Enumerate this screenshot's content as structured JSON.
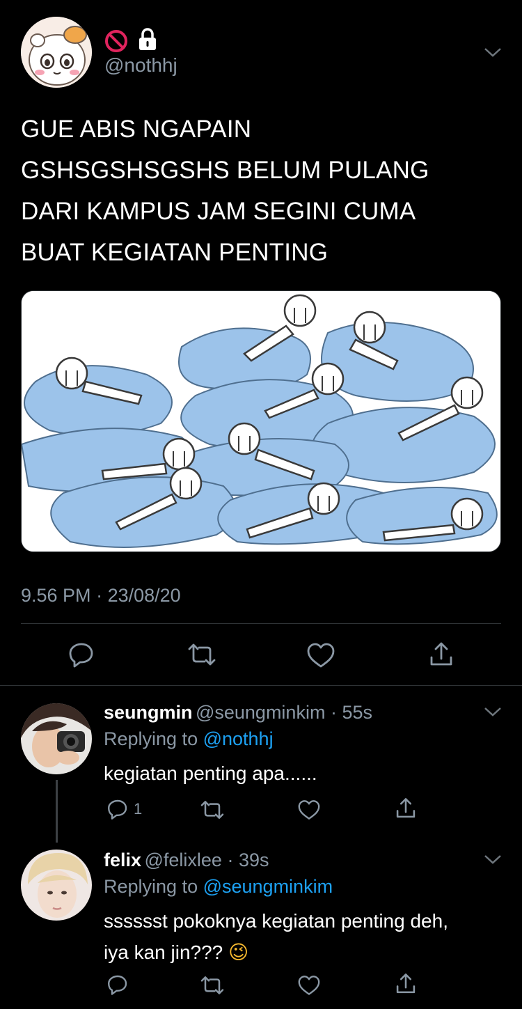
{
  "main_tweet": {
    "handle": "@nothhj",
    "status_icons": [
      "no-entry-icon",
      "lock-icon"
    ],
    "text_lines": [
      "GUE ABIS NGAPAIN",
      "GSHSGSHSGSHS BELUM PULANG",
      "DARI KAMPUS JAM SEGINI CUMA",
      "BUAT KEGIATAN PENTING"
    ],
    "time": "9.56 PM",
    "separator": " · ",
    "date": "23/08/20"
  },
  "replies": [
    {
      "name": "seungmin",
      "handle": "@seungminkim",
      "dot": " · ",
      "time": "55s",
      "replying_prefix": "Replying to ",
      "replying_to": "@nothhj",
      "text_lines": [
        "kegiatan penting apa......"
      ],
      "reply_count": "1"
    },
    {
      "name": "felix",
      "handle": "@felixlee",
      "dot": " · ",
      "time": "39s",
      "replying_prefix": "Replying to ",
      "replying_to": "@seungminkim",
      "text_lines": [
        "sssssst pokoknya kegiatan penting deh,",
        "iya kan jin???"
      ],
      "emoji": "😉"
    }
  ],
  "colors": {
    "background": "#000000",
    "text": "#ffffff",
    "secondary": "#8b98a5",
    "mention": "#1da1f2",
    "puddle": "#9cc3ea",
    "no_entry": "#e0245e"
  }
}
